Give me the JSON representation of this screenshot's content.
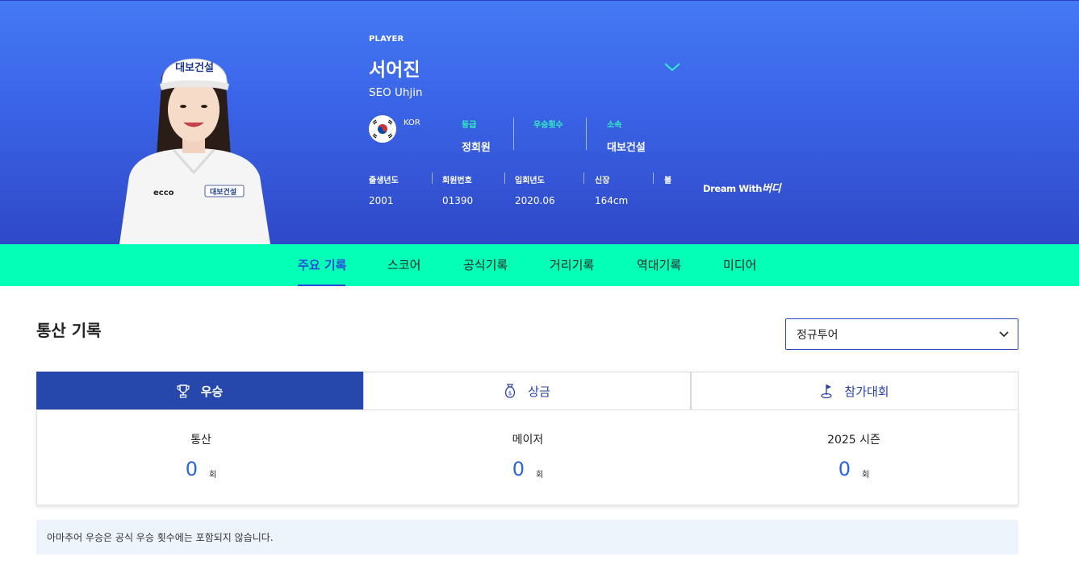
{
  "player": {
    "tag": "PLAYER",
    "name_ko": "서어진",
    "name_en": "SEO Uhjin",
    "country": "KOR",
    "visor_text": "대보건설",
    "stats": [
      {
        "label": "등급",
        "value": "정회원"
      },
      {
        "label": "우승횟수",
        "value": ""
      },
      {
        "label": "소속",
        "value": "대보건설"
      }
    ],
    "meta": [
      {
        "label": "출생년도",
        "value": "2001"
      },
      {
        "label": "회원번호",
        "value": "01390"
      },
      {
        "label": "입회년도",
        "value": "2020.06"
      },
      {
        "label": "신장",
        "value": "164cm"
      },
      {
        "label": "볼",
        "value": ""
      }
    ],
    "sponsor": {
      "prefix": "Dream With",
      "brand": "버디"
    }
  },
  "nav": {
    "items": [
      "주요 기록",
      "스코어",
      "공식기록",
      "거리기록",
      "역대기록",
      "미디어"
    ],
    "active_index": 0
  },
  "section": {
    "title": "통산 기록",
    "tour_select": {
      "value": "정규투어"
    }
  },
  "tabs": [
    {
      "label": "우승",
      "icon": "trophy-icon",
      "active": true
    },
    {
      "label": "상금",
      "icon": "money-bag-icon",
      "active": false
    },
    {
      "label": "참가대회",
      "icon": "golf-flag-icon",
      "active": false
    }
  ],
  "records": [
    {
      "label": "통산",
      "value": "0",
      "unit": "회"
    },
    {
      "label": "메이저",
      "value": "0",
      "unit": "회"
    },
    {
      "label": "2025 시즌",
      "value": "0",
      "unit": "회"
    }
  ],
  "note": "아마추어 우승은 공식 우승 횟수에는 포함되지 않습니다.",
  "colors": {
    "hero_top": "#4479f4",
    "hero_bottom": "#2f49c8",
    "nav_bg": "#04ffb7",
    "accent_blue": "#2a49d8",
    "tab_active": "#2648ad",
    "stat_label": "#2ff0c0",
    "record_number": "#2a63e6"
  }
}
